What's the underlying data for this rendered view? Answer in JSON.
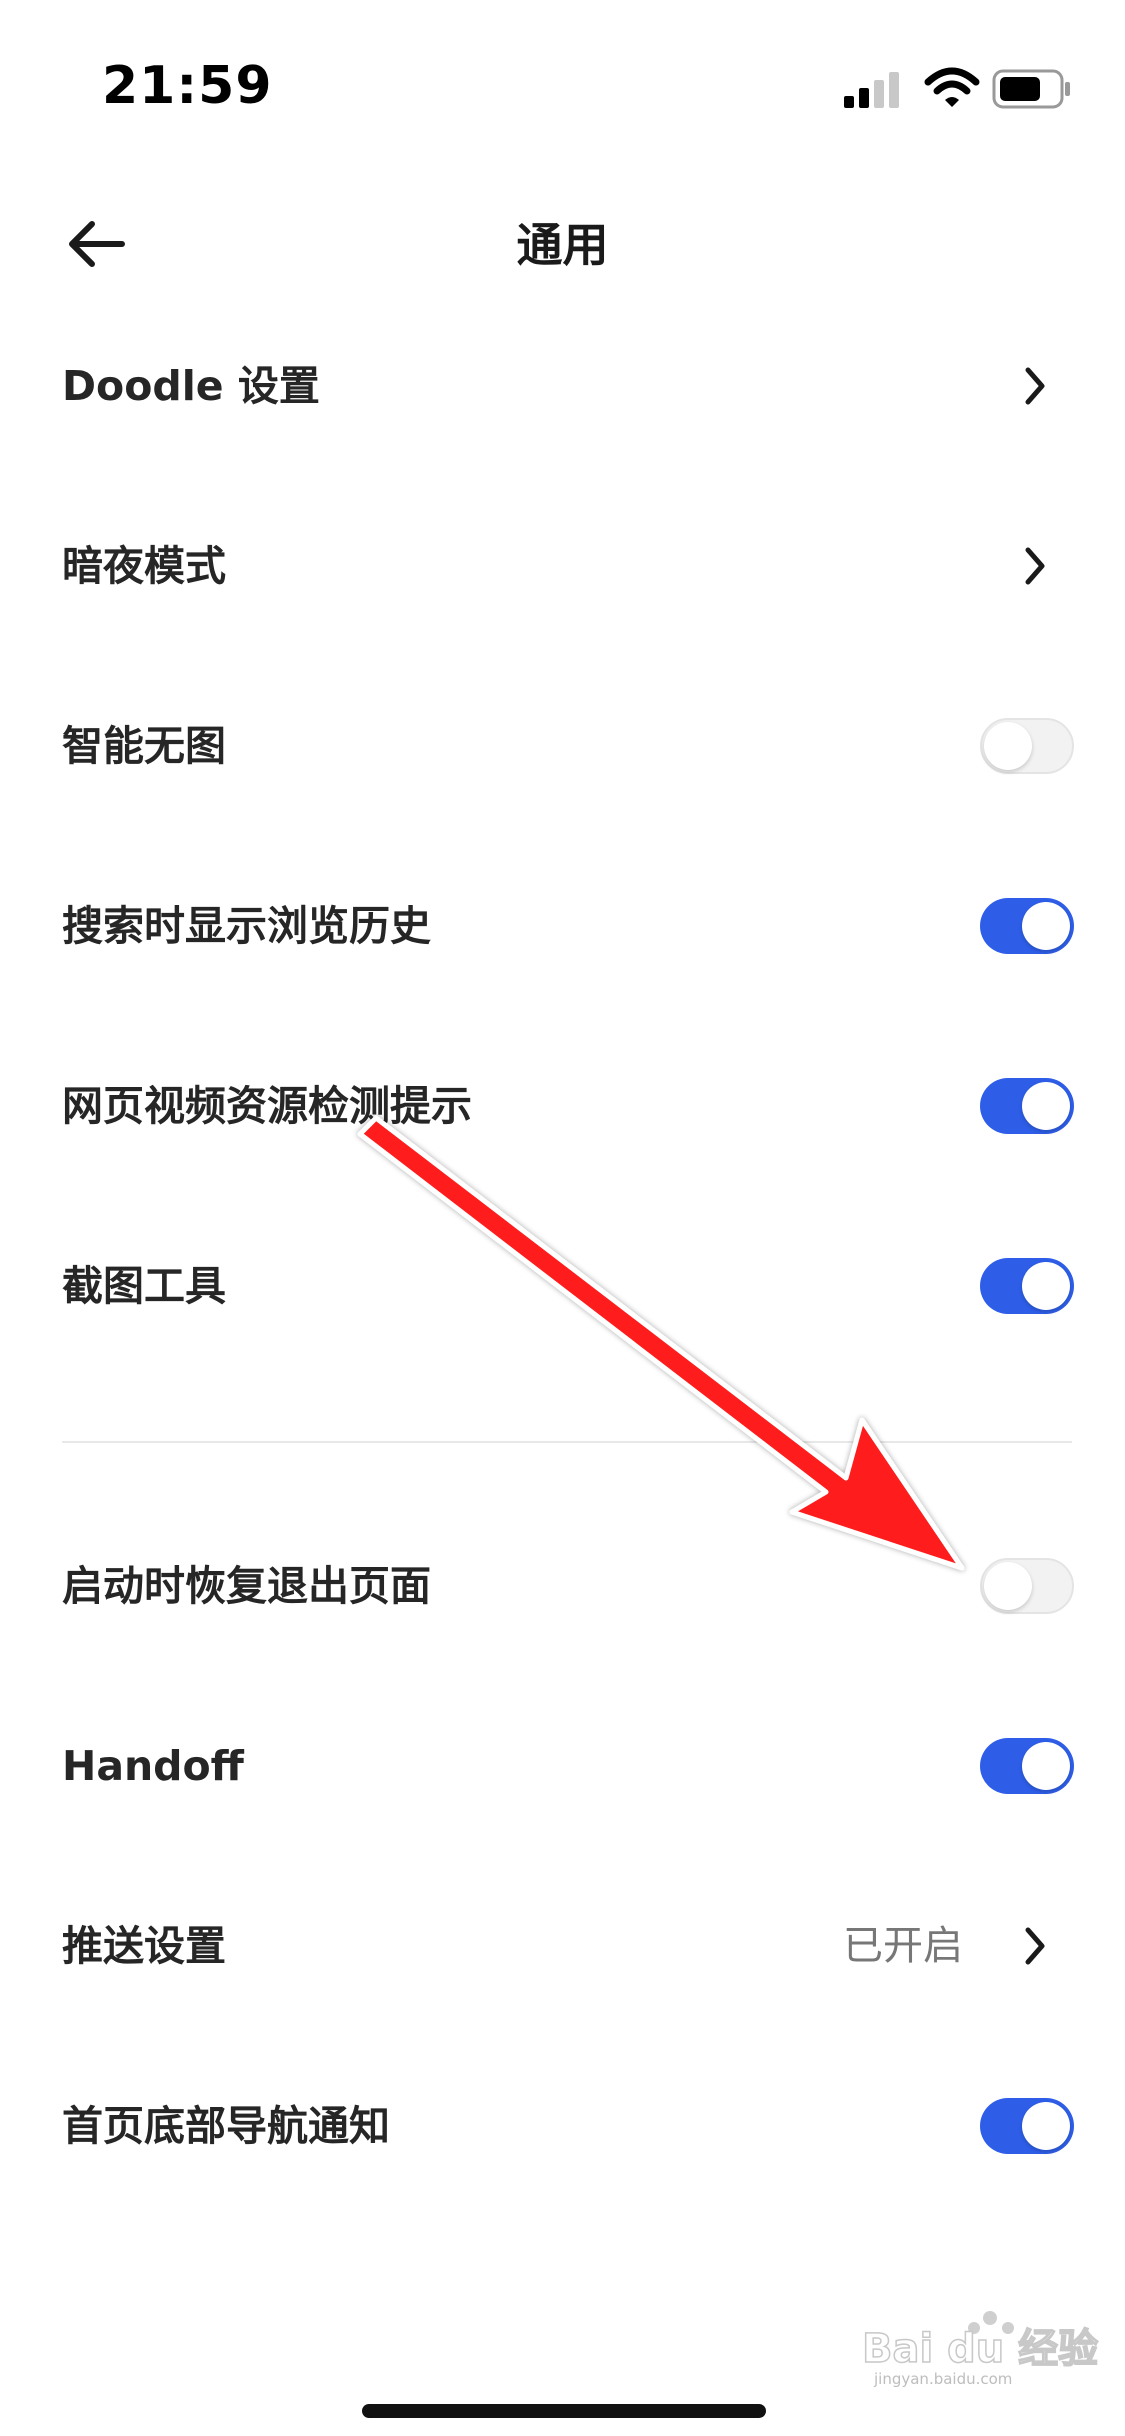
{
  "status_bar": {
    "time": "21:59",
    "signal_icon": "cellular-signal-icon",
    "wifi_icon": "wifi-icon",
    "battery_icon": "battery-icon"
  },
  "nav": {
    "title": "通用",
    "back_icon": "arrow-left-icon"
  },
  "settings": [
    {
      "label": "Doodle 设置",
      "control": "chevron"
    },
    {
      "label": "暗夜模式",
      "control": "chevron"
    },
    {
      "label": "智能无图",
      "control": "toggle",
      "on": false
    },
    {
      "label": "搜索时显示浏览历史",
      "control": "toggle",
      "on": true
    },
    {
      "label": "网页视频资源检测提示",
      "control": "toggle",
      "on": true
    },
    {
      "label": "截图工具",
      "control": "toggle",
      "on": true
    },
    {
      "label": "启动时恢复退出页面",
      "control": "toggle",
      "on": false
    },
    {
      "label": "Handoff",
      "control": "toggle",
      "on": true
    },
    {
      "label": "推送设置",
      "control": "chevron",
      "value": "已开启"
    },
    {
      "label": "首页底部导航通知",
      "control": "toggle",
      "on": true
    }
  ],
  "watermark": {
    "text": "Bai du 经验",
    "subtext": "jingyan.baidu.com"
  },
  "colors": {
    "toggle_on": "#2e5ee8",
    "toggle_off": "#f2f2f2",
    "annotation_arrow": "#ff1a1a"
  }
}
